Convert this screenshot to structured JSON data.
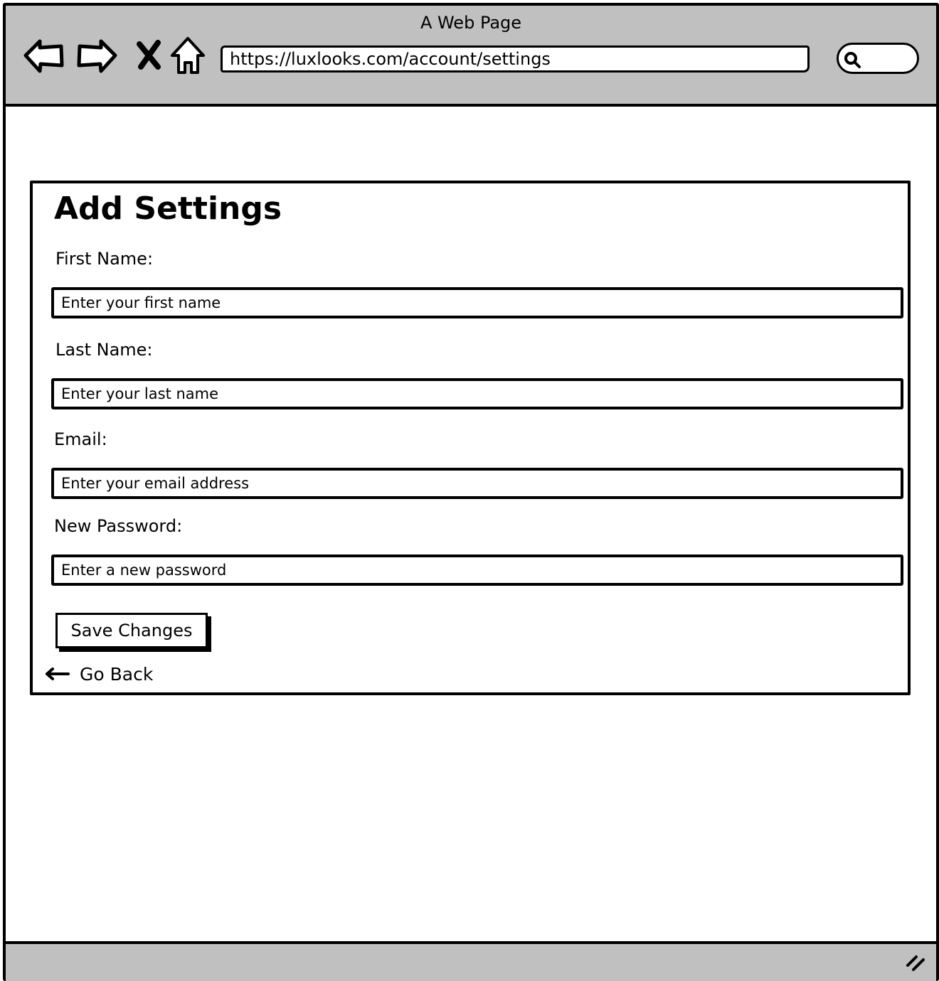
{
  "window": {
    "title": "A Web Page"
  },
  "toolbar": {
    "back_icon": "back-arrow-icon",
    "forward_icon": "forward-arrow-icon",
    "stop_icon": "close-icon",
    "home_icon": "home-icon",
    "url": "https://luxlooks.com/account/settings",
    "search_icon": "search-icon"
  },
  "form": {
    "heading": "Add Settings",
    "fields": [
      {
        "label": "First Name:",
        "placeholder": "Enter your first name"
      },
      {
        "label": "Last Name:",
        "placeholder": "Enter your last name"
      },
      {
        "label": "Email:",
        "placeholder": "Enter your email address"
      },
      {
        "label": "New Password:",
        "placeholder": "Enter a new password"
      }
    ],
    "save_label": "Save Changes",
    "back_label": "Go Back",
    "back_icon": "left-arrow-icon"
  },
  "statusbar": {
    "grip_icon": "resize-grip-icon"
  }
}
